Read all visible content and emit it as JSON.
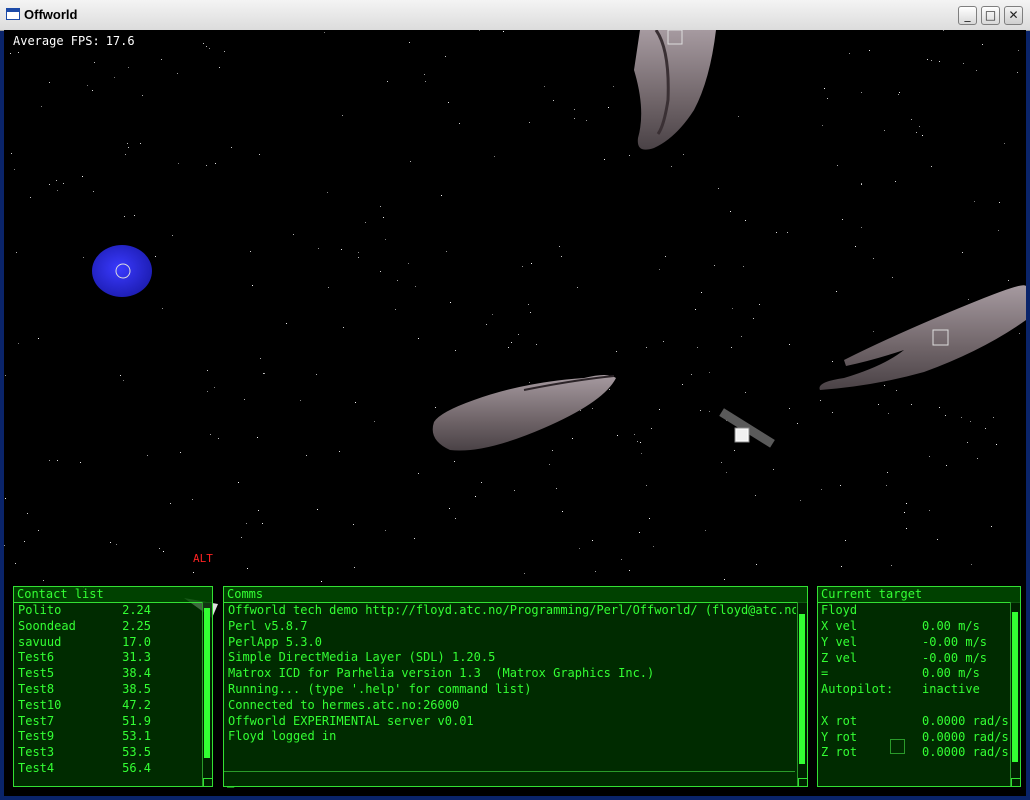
{
  "window": {
    "title": "Offworld",
    "buttons": [
      "minimize",
      "maximize",
      "close"
    ]
  },
  "hud": {
    "fps_label": "Average FPS:",
    "fps_value": "17.6",
    "alt_label": "ALT"
  },
  "contact_list": {
    "title": "Contact list",
    "items": [
      {
        "name": "Polito",
        "distance": "2.24"
      },
      {
        "name": "Soondead",
        "distance": "2.25"
      },
      {
        "name": "savuud",
        "distance": "17.0"
      },
      {
        "name": "Test6",
        "distance": "31.3"
      },
      {
        "name": "Test5",
        "distance": "38.4"
      },
      {
        "name": "Test8",
        "distance": "38.5"
      },
      {
        "name": "Test10",
        "distance": "47.2"
      },
      {
        "name": "Test7",
        "distance": "51.9"
      },
      {
        "name": "Test9",
        "distance": "53.1"
      },
      {
        "name": "Test3",
        "distance": "53.5"
      },
      {
        "name": "Test4",
        "distance": "56.4"
      }
    ]
  },
  "comms": {
    "title": "Comms",
    "lines": [
      "Offworld tech demo http://floyd.atc.no/Programming/Perl/Offworld/ (floyd@atc.no)",
      "Perl v5.8.7",
      "PerlApp 5.3.0",
      "Simple DirectMedia Layer (SDL) 1.20.5",
      "Matrox ICD for Parhelia version 1.3  (Matrox Graphics Inc.)",
      "Running... (type '.help' for command list)",
      "Connected to hermes.atc.no:26000",
      "Offworld EXPERIMENTAL server v0.01",
      "Floyd logged in"
    ],
    "input_value": "_"
  },
  "current_target": {
    "title": "Current target",
    "name": "Floyd",
    "rows": [
      {
        "label": "X vel",
        "value": "0.00 m/s"
      },
      {
        "label": "Y vel",
        "value": "-0.00 m/s"
      },
      {
        "label": "Z vel",
        "value": "-0.00 m/s"
      },
      {
        "label": "=",
        "value": "0.00 m/s"
      },
      {
        "label": "Autopilot:",
        "value": "inactive"
      },
      {
        "label": "",
        "value": ""
      },
      {
        "label": "X rot",
        "value": "0.0000 rad/s"
      },
      {
        "label": "Y rot",
        "value": "0.0000 rad/s"
      },
      {
        "label": "Z rot",
        "value": "0.0000 rad/s"
      }
    ]
  },
  "colors": {
    "hud_green": "#33ff33",
    "alert_red": "#ff2222",
    "planet_blue": "#2a2ad8"
  }
}
